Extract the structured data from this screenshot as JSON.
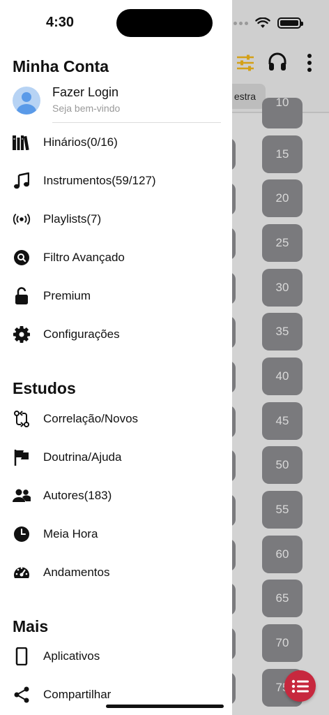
{
  "status_bar": {
    "time": "4:30"
  },
  "background": {
    "tab_label": "estra",
    "numbers": [
      "10",
      "15",
      "20",
      "25",
      "30",
      "35",
      "40",
      "45",
      "50",
      "55",
      "60",
      "65",
      "70",
      "75"
    ],
    "accent_color": "#d4a017",
    "fab_color": "#c7283e"
  },
  "drawer": {
    "account_section_title": "Minha Conta",
    "account": {
      "name": "Fazer Login",
      "subtitle": "Seja bem-vindo"
    },
    "main_items": [
      {
        "label": "Hinários(0/16)",
        "icon": "books-icon"
      },
      {
        "label": "Instrumentos(59/127)",
        "icon": "music-note-icon"
      },
      {
        "label": "Playlists(7)",
        "icon": "broadcast-icon"
      },
      {
        "label": "Filtro Avançado",
        "icon": "search-icon"
      },
      {
        "label": "Premium",
        "icon": "unlock-icon"
      },
      {
        "label": "Configurações",
        "icon": "gear-icon"
      }
    ],
    "studies_section_title": "Estudos",
    "study_items": [
      {
        "label": "Correlação/Novos",
        "icon": "compare-arrows-icon"
      },
      {
        "label": "Doutrina/Ajuda",
        "icon": "flag-icon"
      },
      {
        "label": "Autores(183)",
        "icon": "people-icon"
      },
      {
        "label": "Meia Hora",
        "icon": "clock-icon"
      },
      {
        "label": "Andamentos",
        "icon": "speedometer-icon"
      }
    ],
    "more_section_title": "Mais",
    "more_items": [
      {
        "label": "Aplicativos",
        "icon": "phone-icon"
      },
      {
        "label": "Compartilhar",
        "icon": "share-icon"
      }
    ]
  }
}
